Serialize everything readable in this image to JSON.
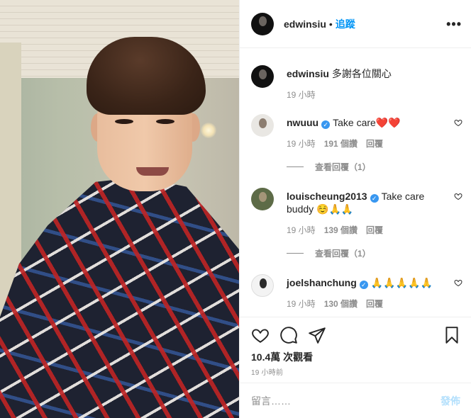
{
  "header": {
    "username": "edwinsiu",
    "separator": "•",
    "follow_label": "追蹤",
    "more_label": "•••"
  },
  "caption": {
    "username": "edwinsiu",
    "text": "多謝各位關心",
    "time": "19 小時"
  },
  "comments": [
    {
      "username": "nwuuu",
      "verified": true,
      "text": "Take care❤️❤️",
      "time": "19 小時",
      "likes": "191 個讚",
      "reply": "回覆",
      "view_replies": "查看回覆（1）"
    },
    {
      "username": "louischeung2013",
      "verified": true,
      "text": "Take care buddy ☺️🙏🙏",
      "time": "19 小時",
      "likes": "139 個讚",
      "reply": "回覆",
      "view_replies": "查看回覆（1）"
    },
    {
      "username": "joelshanchung",
      "verified": true,
      "text": "🙏🙏🙏🙏🙏",
      "time": "19 小時",
      "likes": "130 個讚",
      "reply": "回覆"
    }
  ],
  "stats": {
    "views": "10.4萬 次觀看",
    "time": "19 小時前"
  },
  "comment_box": {
    "placeholder": "留言……",
    "post_label": "發佈"
  },
  "colors": {
    "link": "#0095f6",
    "secondary": "#8e8e8e",
    "verified": "#3897f0",
    "border": "#efefef"
  }
}
